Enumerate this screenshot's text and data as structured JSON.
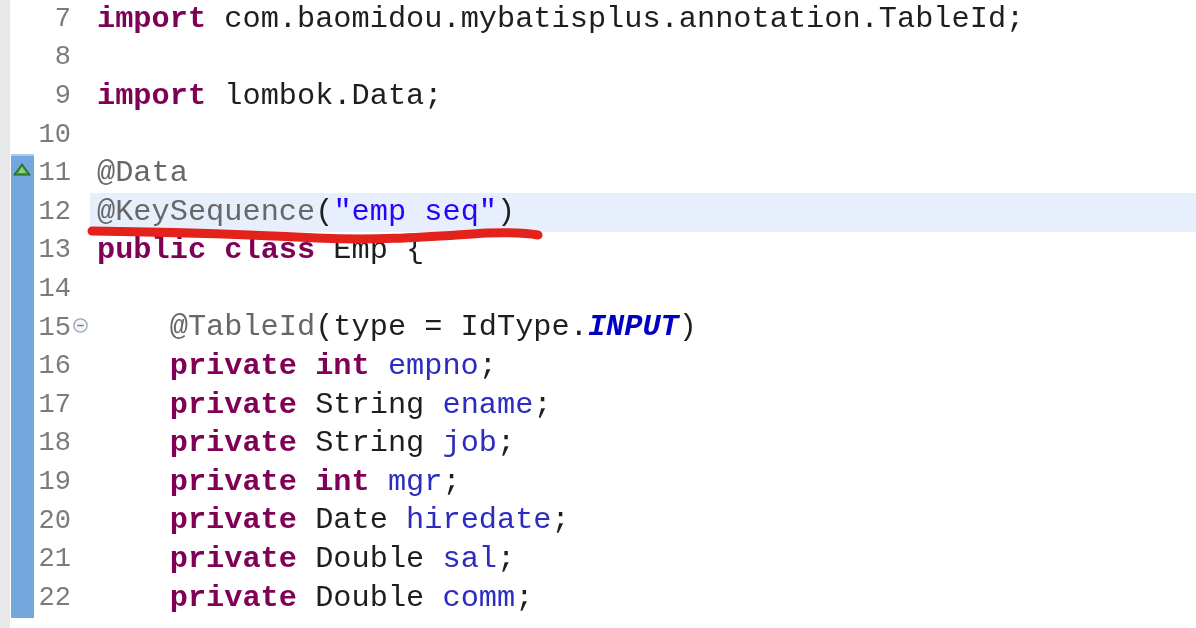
{
  "editor": {
    "lines": [
      {
        "number": "7",
        "tokens": [
          {
            "kind": "keyword",
            "text": "import"
          },
          {
            "kind": "plain",
            "text": " com.baomidou.mybatisplus.annotation.TableId;"
          }
        ]
      },
      {
        "number": "8"
      },
      {
        "number": "9",
        "tokens": [
          {
            "kind": "keyword",
            "text": "import"
          },
          {
            "kind": "plain",
            "text": " lombok.Data;"
          }
        ]
      },
      {
        "number": "10"
      }
    ],
    "declaration": {
      "range": true,
      "lines": [
        {
          "number": "11",
          "override": true,
          "tokens": [
            {
              "kind": "annotation",
              "text": "@Data"
            }
          ]
        },
        {
          "number": "12",
          "current": true,
          "underline": true,
          "tokens": [
            {
              "kind": "annotation",
              "text": "@KeySequence"
            },
            {
              "kind": "plain",
              "text": "("
            },
            {
              "kind": "string",
              "text": "\"emp seq\""
            },
            {
              "kind": "plain",
              "text": ")"
            }
          ]
        },
        {
          "number": "13",
          "tokens": [
            {
              "kind": "keyword",
              "text": "public class"
            },
            {
              "kind": "plain",
              "text": " Emp {"
            }
          ],
          "children": [
            {
              "number": "14"
            },
            {
              "number": "15",
              "collapsed": false,
              "tokens": [
                {
                  "kind": "annotation",
                  "text": "@TableId"
                },
                {
                  "kind": "plain",
                  "text": "(type = IdType."
                },
                {
                  "kind": "constant",
                  "text": "INPUT"
                },
                {
                  "kind": "plain",
                  "text": ")"
                }
              ]
            },
            {
              "number": "16",
              "tokens": [
                {
                  "kind": "keyword",
                  "text": "private int"
                },
                {
                  "kind": "field",
                  "text": " empno"
                },
                {
                  "kind": "plain",
                  "text": ";"
                }
              ]
            },
            {
              "number": "17",
              "tokens": [
                {
                  "kind": "keyword",
                  "text": "private"
                },
                {
                  "kind": "plain",
                  "text": " String"
                },
                {
                  "kind": "field",
                  "text": " ename"
                },
                {
                  "kind": "plain",
                  "text": ";"
                }
              ]
            },
            {
              "number": "18",
              "tokens": [
                {
                  "kind": "keyword",
                  "text": "private"
                },
                {
                  "kind": "plain",
                  "text": " String"
                },
                {
                  "kind": "field",
                  "text": " job"
                },
                {
                  "kind": "plain",
                  "text": ";"
                }
              ]
            },
            {
              "number": "19",
              "tokens": [
                {
                  "kind": "keyword",
                  "text": "private int"
                },
                {
                  "kind": "field",
                  "text": " mgr"
                },
                {
                  "kind": "plain",
                  "text": ";"
                }
              ]
            },
            {
              "number": "20",
              "tokens": [
                {
                  "kind": "keyword",
                  "text": "private"
                },
                {
                  "kind": "plain",
                  "text": " Date"
                },
                {
                  "kind": "field",
                  "text": " hiredate"
                },
                {
                  "kind": "plain",
                  "text": ";"
                }
              ]
            },
            {
              "number": "21",
              "tokens": [
                {
                  "kind": "keyword",
                  "text": "private"
                },
                {
                  "kind": "plain",
                  "text": " Double"
                },
                {
                  "kind": "field",
                  "text": " sal"
                },
                {
                  "kind": "plain",
                  "text": ";"
                }
              ]
            },
            {
              "number": "22",
              "tokens": [
                {
                  "kind": "keyword",
                  "text": "private"
                },
                {
                  "kind": "plain",
                  "text": " Double"
                },
                {
                  "kind": "field",
                  "text": " comm"
                },
                {
                  "kind": "plain",
                  "text": ";"
                }
              ]
            }
          ]
        }
      ]
    }
  }
}
